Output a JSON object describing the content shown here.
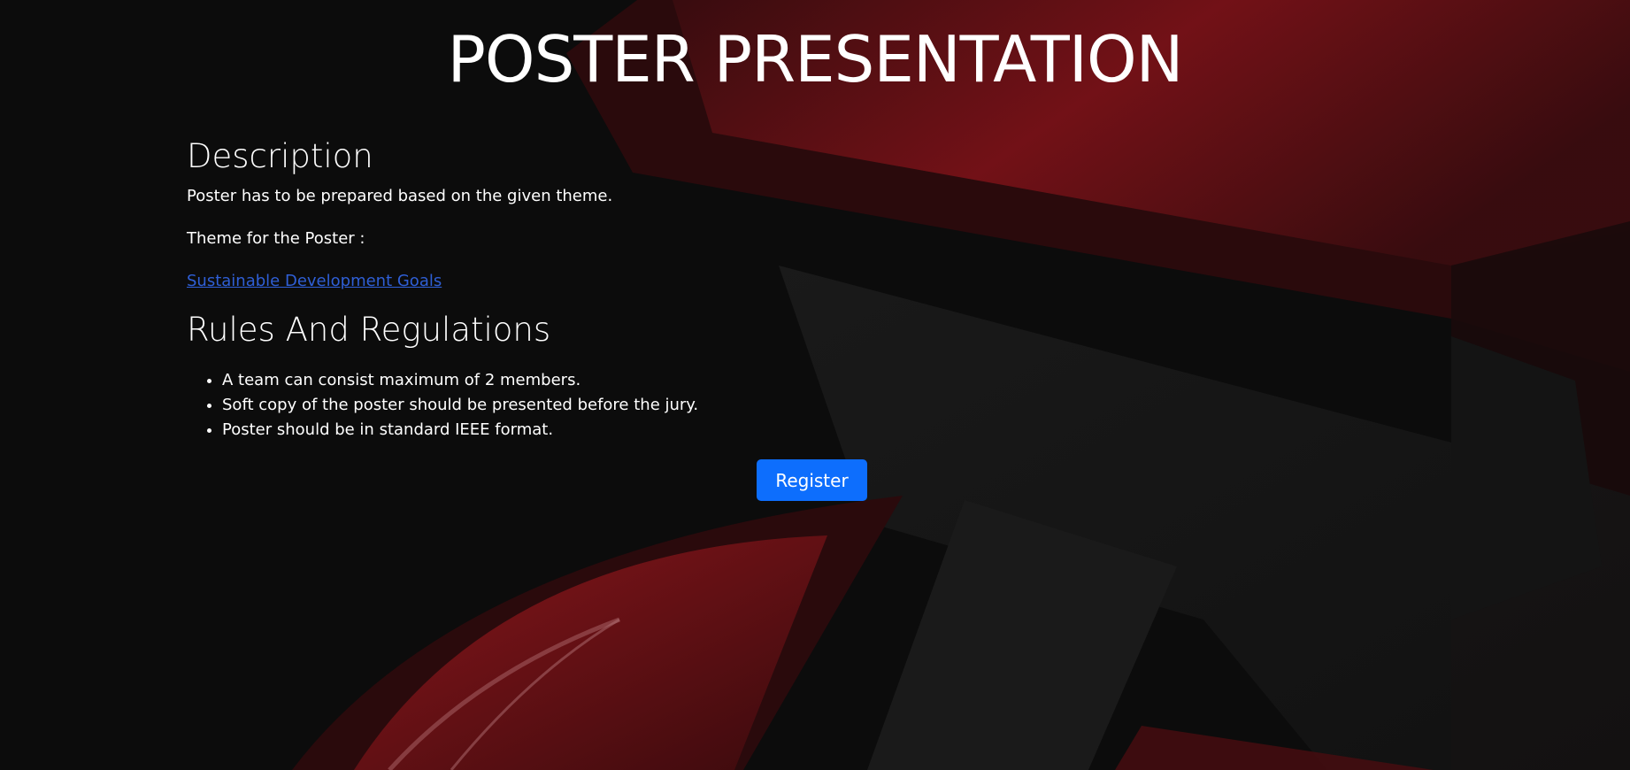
{
  "page": {
    "title": "POSTER PRESENTATION"
  },
  "description": {
    "heading": "Description",
    "text": "Poster has to be prepared based on the given theme.",
    "theme_label": "Theme for the Poster :",
    "theme_link": "Sustainable Development Goals"
  },
  "rules": {
    "heading": "Rules And Regulations",
    "items": [
      "A team can consist maximum of 2 members.",
      "Soft copy of the poster should be presented before the jury.",
      "Poster should be in standard IEEE format."
    ]
  },
  "actions": {
    "register_label": "Register"
  },
  "colors": {
    "background": "#0c0c0c",
    "accent_red": "#7a1218",
    "link": "#2f5fd6",
    "button": "#0d6efd",
    "text": "#ffffff"
  }
}
